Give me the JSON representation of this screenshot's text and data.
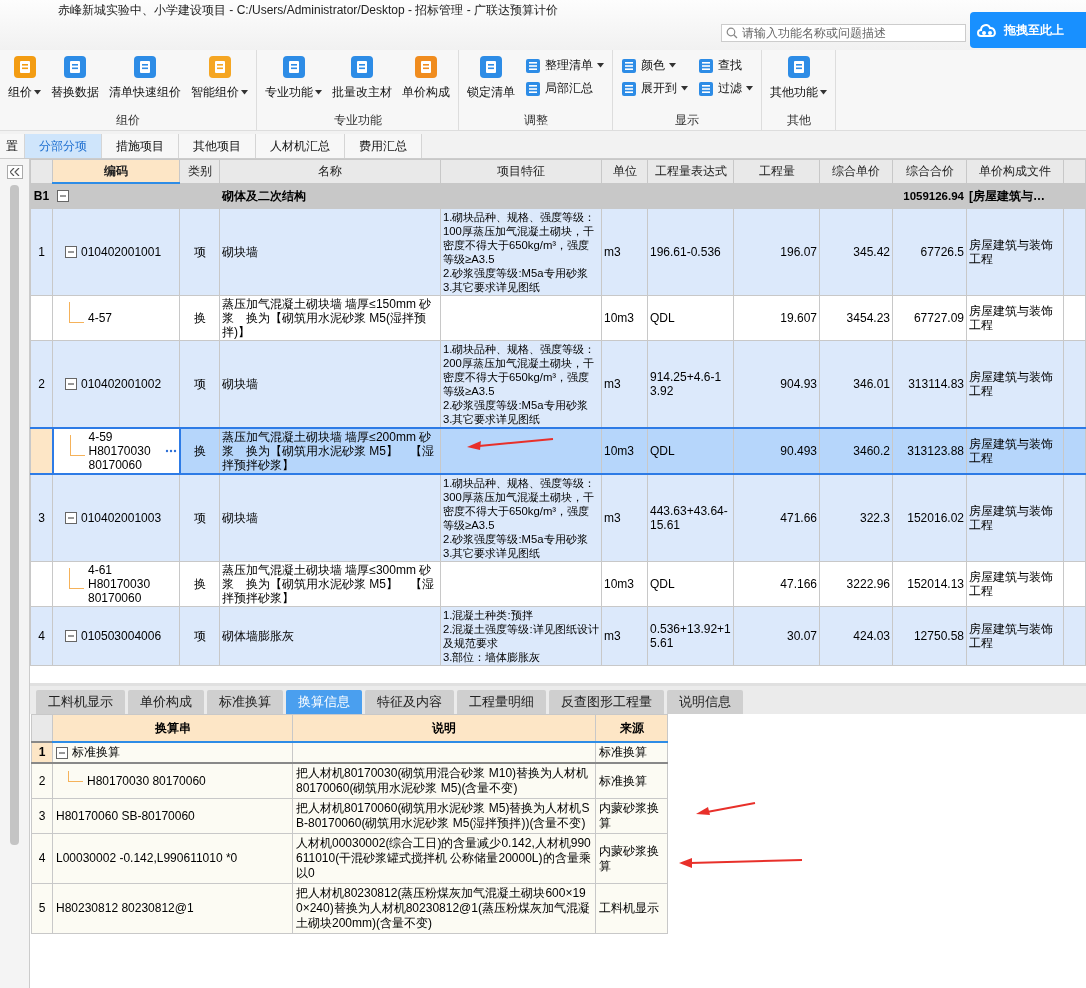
{
  "window": {
    "title": "赤峰新城实验中、小学建设项目 - C:/Users/Administrator/Desktop - 招标管理 - 广联达预算计价"
  },
  "search": {
    "placeholder": "请输入功能名称或问题描述"
  },
  "upload_button": {
    "label": "拖拽至此上"
  },
  "ribbon": {
    "groups": [
      {
        "label": "组价",
        "items": [
          {
            "kind": "button",
            "label": "组价",
            "dropdown": true
          },
          {
            "kind": "button",
            "label": "替换数据",
            "dropdown": false
          },
          {
            "kind": "button",
            "label": "清单快速组价",
            "dropdown": false
          },
          {
            "kind": "button",
            "label": "智能组价",
            "dropdown": true
          }
        ]
      },
      {
        "label": "专业功能",
        "items": [
          {
            "kind": "button",
            "label": "专业功能",
            "dropdown": true
          },
          {
            "kind": "button",
            "label": "批量改主材",
            "dropdown": false
          },
          {
            "kind": "button",
            "label": "单价构成",
            "dropdown": false
          }
        ]
      },
      {
        "label": "调整",
        "items": [
          {
            "kind": "button",
            "label": "锁定清单",
            "dropdown": false
          },
          {
            "kind": "stack",
            "buttons": [
              {
                "label": "整理清单",
                "dropdown": true
              },
              {
                "label": "局部汇总",
                "dropdown": false
              }
            ]
          }
        ]
      },
      {
        "label": "显示",
        "items": [
          {
            "kind": "stack",
            "buttons": [
              {
                "label": "颜色",
                "dropdown": true
              },
              {
                "label": "展开到",
                "dropdown": true
              }
            ]
          },
          {
            "kind": "stack",
            "buttons": [
              {
                "label": "查找",
                "dropdown": false
              },
              {
                "label": "过滤",
                "dropdown": true
              }
            ]
          }
        ]
      },
      {
        "label": "其他",
        "items": [
          {
            "kind": "button",
            "label": "其他功能",
            "dropdown": true
          }
        ]
      }
    ]
  },
  "tabs": [
    {
      "label": "置",
      "selected": false
    },
    {
      "label": "分部分项",
      "selected": true
    },
    {
      "label": "措施项目",
      "selected": false
    },
    {
      "label": "其他项目",
      "selected": false
    },
    {
      "label": "人材机汇总",
      "selected": false
    },
    {
      "label": "费用汇总",
      "selected": false
    }
  ],
  "table": {
    "columns": [
      "编码",
      "类别",
      "名称",
      "项目特征",
      "单位",
      "工程量表达式",
      "工程量",
      "综合单价",
      "综合合价",
      "单价构成文件"
    ],
    "rows": [
      {
        "kind": "section",
        "number": "B1",
        "expanded": true,
        "name": "砌体及二次结构",
        "total": "1059126.94",
        "file": "[房屋建筑与…",
        "selected": false,
        "children": [
          {
            "kind": "item",
            "number": "1",
            "code": "010402001001",
            "expanded": true,
            "type": "项",
            "name": "砌块墙",
            "features": "1.砌块品种、规格、强度等级：100厚蒸压加气混凝土砌块，干密度不得大于650kg/m³，强度等级≥A3.5\n2.砂浆强度等级:M5a专用砂浆\n3.其它要求详见图纸",
            "unit": "m3",
            "expression": "196.61-0.536",
            "quantity": "196.07",
            "unit_price": "345.42",
            "total": "67726.5",
            "file": "房屋建筑与装饰工程",
            "selected": false,
            "children": [
              {
                "kind": "sub",
                "code": "4-57",
                "type": "换",
                "name": "蒸压加气混凝土砌块墙 墙厚≤150mm 砂浆　换为【砌筑用水泥砂浆 M5(湿拌预拌)】",
                "unit": "10m3",
                "expression": "QDL",
                "quantity": "19.607",
                "unit_price": "3454.23",
                "total": "67727.09",
                "file": "房屋建筑与装饰工程",
                "selected": false
              }
            ]
          },
          {
            "kind": "item",
            "number": "2",
            "code": "010402001002",
            "expanded": true,
            "type": "项",
            "name": "砌块墙",
            "features": "1.砌块品种、规格、强度等级：200厚蒸压加气混凝土砌块，干密度不得大于650kg/m³，强度等级≥A3.5\n2.砂浆强度等级:M5a专用砂浆\n3.其它要求详见图纸",
            "unit": "m3",
            "expression": "914.25+4.6-13.92",
            "quantity": "904.93",
            "unit_price": "346.01",
            "total": "313114.83",
            "file": "房屋建筑与装饰工程",
            "selected": false,
            "children": [
              {
                "kind": "sub",
                "code": "4-59 H80170030 80170060",
                "type": "换",
                "name": "蒸压加气混凝土砌块墙 墙厚≤200mm 砂浆　换为【砌筑用水泥砂浆 M5】　【湿拌预拌砂浆】",
                "unit": "10m3",
                "expression": "QDL",
                "quantity": "90.493",
                "unit_price": "3460.2",
                "total": "313123.88",
                "file": "房屋建筑与装饰工程",
                "selected": true
              }
            ]
          },
          {
            "kind": "item",
            "number": "3",
            "code": "010402001003",
            "expanded": true,
            "type": "项",
            "name": "砌块墙",
            "features": "1.砌块品种、规格、强度等级：300厚蒸压加气混凝土砌块，干密度不得大于650kg/m³，强度等级≥A3.5\n2.砂浆强度等级:M5a专用砂浆\n3.其它要求详见图纸",
            "unit": "m3",
            "expression": "443.63+43.64-15.61",
            "quantity": "471.66",
            "unit_price": "322.3",
            "total": "152016.02",
            "file": "房屋建筑与装饰工程",
            "selected": false,
            "children": [
              {
                "kind": "sub",
                "code": "4-61 H80170030 80170060",
                "type": "换",
                "name": "蒸压加气混凝土砌块墙 墙厚≤300mm 砂浆　换为【砌筑用水泥砂浆 M5】　【湿拌预拌砂浆】",
                "unit": "10m3",
                "expression": "QDL",
                "quantity": "47.166",
                "unit_price": "3222.96",
                "total": "152014.13",
                "file": "房屋建筑与装饰工程",
                "selected": false
              }
            ]
          },
          {
            "kind": "item",
            "number": "4",
            "code": "010503004006",
            "expanded": true,
            "type": "项",
            "name": "砌体墙膨胀灰",
            "features": "1.混凝土种类:预拌\n2.混凝土强度等级:详见图纸设计及规范要求\n3.部位：墙体膨胀灰",
            "unit": "m3",
            "expression": "0.536+13.92+15.61",
            "quantity": "30.07",
            "unit_price": "424.03",
            "total": "12750.58",
            "file": "房屋建筑与装饰工程",
            "selected": false
          }
        ]
      }
    ]
  },
  "bottom_tabs": [
    {
      "label": "工料机显示",
      "selected": false
    },
    {
      "label": "单价构成",
      "selected": false
    },
    {
      "label": "标准换算",
      "selected": false
    },
    {
      "label": "换算信息",
      "selected": true
    },
    {
      "label": "特征及内容",
      "selected": false
    },
    {
      "label": "工程量明细",
      "selected": false
    },
    {
      "label": "反查图形工程量",
      "selected": false
    },
    {
      "label": "说明信息",
      "selected": false
    }
  ],
  "conversion_table": {
    "columns": [
      "换算串",
      "说明",
      "来源"
    ],
    "rows": [
      {
        "number": "1",
        "expression": "标准换算",
        "expanded": true,
        "source": "标准换算",
        "selected": true,
        "children": [
          {
            "number": "2",
            "expression": "H80170030 80170060",
            "description": "把人材机80170030(砌筑用混合砂浆 M10)替换为人材机80170060(砌筑用水泥砂浆 M5)(含量不变)",
            "source": "标准换算",
            "selected": false
          }
        ]
      },
      {
        "number": "3",
        "expression": "H80170060 SB-80170060",
        "description": "把人材机80170060(砌筑用水泥砂浆 M5)替换为人材机SB-80170060(砌筑用水泥砂浆 M5(湿拌预拌))(含量不变)",
        "source": "内蒙砂浆换算",
        "selected": false
      },
      {
        "number": "4",
        "expression": "L00030002 -0.142,L990611010 *0",
        "description": "人材机00030002(综合工日)的含量减少0.142,人材机990611010(干混砂浆罐式搅拌机 公称储量20000L)的含量乘以0",
        "source": "内蒙砂浆换算",
        "selected": false
      },
      {
        "number": "5",
        "expression": "H80230812 80230812@1",
        "description": "把人材机80230812(蒸压粉煤灰加气混凝土砌块600×190×240)替换为人材机80230812@1(蒸压粉煤灰加气混凝土砌块200mm)(含量不变)",
        "source": "工料机显示",
        "selected": false
      }
    ]
  }
}
